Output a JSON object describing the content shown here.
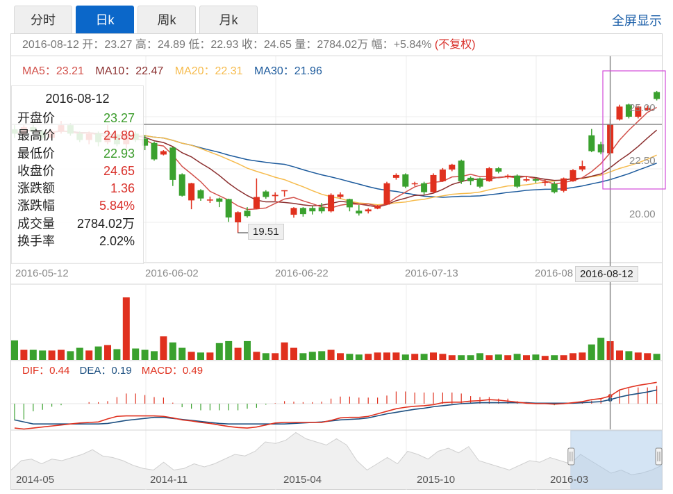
{
  "tabs": [
    {
      "label": "分时",
      "active": false
    },
    {
      "label": "日k",
      "active": true
    },
    {
      "label": "周k",
      "active": false
    },
    {
      "label": "月k",
      "active": false
    }
  ],
  "fullscreen_label": "全屏显示",
  "info": {
    "date": "2016-08-12",
    "open_label": "开：",
    "open": "23.27",
    "high_label": "高：",
    "high": "24.89",
    "low_label": "低：",
    "low": "22.93",
    "close_label": "收：",
    "close": "24.65",
    "volume_label": "量：",
    "volume": "2784.02万",
    "change_label": "幅：",
    "change": "+5.84%",
    "adjust": "(不复权)"
  },
  "ma": {
    "ma5": "MA5：23.21",
    "ma10": "MA10：22.47",
    "ma20": "MA20：22.31",
    "ma30": "MA30：21.96"
  },
  "tooltip": {
    "date": "2016-08-12",
    "rows": [
      {
        "label": "开盘价",
        "value": "23.27",
        "tone": "down"
      },
      {
        "label": "最高价",
        "value": "24.89",
        "tone": "up"
      },
      {
        "label": "最低价",
        "value": "22.93",
        "tone": "down"
      },
      {
        "label": "收盘价",
        "value": "24.65",
        "tone": "up"
      },
      {
        "label": "涨跌额",
        "value": "1.36",
        "tone": "up"
      },
      {
        "label": "涨跌幅",
        "value": "5.84%",
        "tone": "up"
      },
      {
        "label": "成交量",
        "value": "2784.02万",
        "tone": "plain"
      },
      {
        "label": "换手率",
        "value": "2.02%",
        "tone": "plain"
      }
    ]
  },
  "colors": {
    "up": "#e0301e",
    "down": "#3aa12e",
    "ma5": "#d2504a",
    "ma10": "#8b2f2f",
    "ma20": "#f6bb4c",
    "ma30": "#1c5a9c",
    "dif": "#e0301e",
    "dea": "#1c4f80",
    "accent": "#0b67c9"
  },
  "chart_data": {
    "type": "candlestick",
    "price_ticks": [
      "25.00",
      "22.50",
      "20.00"
    ],
    "price_tick_values": [
      25,
      22.5,
      20
    ],
    "x_labels": [
      "2016-05-12",
      "2016-06-02",
      "2016-06-22",
      "2016-07-13",
      "2016-08"
    ],
    "x_label_index": [
      0,
      14,
      28,
      42,
      56
    ],
    "selected_index": 64,
    "selected_date": "2016-08-12",
    "min_label": "19.51",
    "min_index": 24,
    "ohlc": [
      [
        24.4,
        24.2,
        24.6,
        24.0
      ],
      [
        24.2,
        24.5,
        24.6,
        24.1
      ],
      [
        24.5,
        24.3,
        24.7,
        24.2
      ],
      [
        24.3,
        24.0,
        24.4,
        23.9
      ],
      [
        24.0,
        24.3,
        24.4,
        23.9
      ],
      [
        24.3,
        24.6,
        24.8,
        24.2
      ],
      [
        24.6,
        24.2,
        24.7,
        24.1
      ],
      [
        24.2,
        23.9,
        24.3,
        23.8
      ],
      [
        23.9,
        24.2,
        24.3,
        23.7
      ],
      [
        24.2,
        23.8,
        24.3,
        23.6
      ],
      [
        23.8,
        24.1,
        24.6,
        23.7
      ],
      [
        24.1,
        23.7,
        24.2,
        23.6
      ],
      [
        23.7,
        24.2,
        24.4,
        23.5
      ],
      [
        24.2,
        23.9,
        24.3,
        23.8
      ],
      [
        23.96,
        23.63,
        24.12,
        23.42
      ],
      [
        23.76,
        22.98,
        23.82,
        22.92
      ],
      [
        23.21,
        23.37,
        23.42,
        23.17
      ],
      [
        23.54,
        22.01,
        23.57,
        21.72
      ],
      [
        22.27,
        21.26,
        22.32,
        21.22
      ],
      [
        21.04,
        21.85,
        21.87,
        20.62
      ],
      [
        21.52,
        21.13,
        21.57,
        21.02
      ],
      [
        21.04,
        21.08,
        21.22,
        20.92
      ],
      [
        21.13,
        20.97,
        21.17,
        20.72
      ],
      [
        21.1,
        20.23,
        21.12,
        20.02
      ],
      [
        20.0,
        20.48,
        20.52,
        19.51
      ],
      [
        20.55,
        20.29,
        20.72,
        20.22
      ],
      [
        20.65,
        21.2,
        22.08,
        20.62
      ],
      [
        21.46,
        21.2,
        21.52,
        21.12
      ],
      [
        21.24,
        21.3,
        21.42,
        21.02
      ],
      [
        21.49,
        21.52,
        21.52,
        21.22
      ],
      [
        20.36,
        20.68,
        20.72,
        20.22
      ],
      [
        20.68,
        20.39,
        20.72,
        20.27
      ],
      [
        20.68,
        20.52,
        20.77,
        20.37
      ],
      [
        20.71,
        20.52,
        20.92,
        20.42
      ],
      [
        20.52,
        21.3,
        21.37,
        20.47
      ],
      [
        21.2,
        21.32,
        21.42,
        21.12
      ],
      [
        21.1,
        20.71,
        21.12,
        20.52
      ],
      [
        20.55,
        20.42,
        20.82,
        20.32
      ],
      [
        20.52,
        20.61,
        20.67,
        20.42
      ],
      [
        20.65,
        20.77,
        20.82,
        20.62
      ],
      [
        20.84,
        21.85,
        21.92,
        20.82
      ],
      [
        22.11,
        22.24,
        22.32,
        22.02
      ],
      [
        22.27,
        21.69,
        22.32,
        21.62
      ],
      [
        21.82,
        21.85,
        21.92,
        21.72
      ],
      [
        21.85,
        21.43,
        21.92,
        21.32
      ],
      [
        21.43,
        22.24,
        22.32,
        21.37
      ],
      [
        21.95,
        22.5,
        22.57,
        21.92
      ],
      [
        22.5,
        22.73,
        22.77,
        22.42
      ],
      [
        22.92,
        21.95,
        22.97,
        21.82
      ],
      [
        22.11,
        21.95,
        22.17,
        21.77
      ],
      [
        22.08,
        21.69,
        22.12,
        21.62
      ],
      [
        21.95,
        22.56,
        22.62,
        21.92
      ],
      [
        22.56,
        22.4,
        22.62,
        22.32
      ],
      [
        22.14,
        22.21,
        22.27,
        22.07
      ],
      [
        22.21,
        21.69,
        22.27,
        21.62
      ],
      [
        21.98,
        22.04,
        22.17,
        21.92
      ],
      [
        22.04,
        21.97,
        22.12,
        21.87
      ],
      [
        21.87,
        21.92,
        22.02,
        21.72
      ],
      [
        21.82,
        21.43,
        21.92,
        21.37
      ],
      [
        21.49,
        22.08,
        22.12,
        21.42
      ],
      [
        21.95,
        22.47,
        22.52,
        21.92
      ],
      [
        22.5,
        22.66,
        22.92,
        22.42
      ],
      [
        24.12,
        23.37,
        24.42,
        23.32
      ],
      [
        23.7,
        23.31,
        23.82,
        23.22
      ],
      [
        23.27,
        24.65,
        24.89,
        22.93
      ],
      [
        24.87,
        25.48,
        25.57,
        24.82
      ],
      [
        25.58,
        25.0,
        25.62,
        24.92
      ],
      [
        25.0,
        25.48,
        25.52,
        24.92
      ],
      [
        25.32,
        25.42,
        25.52,
        25.27
      ],
      [
        26.17,
        25.84,
        26.22,
        25.77
      ]
    ],
    "volume_wan": [
      2900,
      1500,
      1500,
      1400,
      1400,
      1500,
      1300,
      1800,
      1400,
      2000,
      2200,
      1600,
      9300,
      1700,
      1500,
      1300,
      3500,
      2600,
      1800,
      1200,
      1100,
      1100,
      2500,
      2800,
      1800,
      2800,
      1200,
      1000,
      1000,
      2600,
      1800,
      1000,
      1200,
      1300,
      1500,
      1000,
      900,
      800,
      900,
      1100,
      1100,
      1100,
      800,
      900,
      900,
      1100,
      900,
      700,
      700,
      700,
      1000,
      700,
      800,
      700,
      900,
      700,
      800,
      600,
      700,
      700,
      1000,
      1100,
      2300,
      3300,
      2784,
      1400,
      1300,
      1100,
      1000,
      900
    ],
    "macd": [
      -0.33,
      -0.31,
      -0.15,
      -0.12,
      -0.06,
      -0.03,
      0,
      0,
      0.03,
      0.03,
      0.05,
      0.13,
      0.2,
      0.2,
      0.17,
      0.13,
      0.12,
      0.02,
      -0.07,
      -0.1,
      -0.13,
      -0.13,
      -0.13,
      -0.13,
      -0.13,
      -0.1,
      -0.08,
      -0.02,
      0.01,
      0.05,
      0.04,
      0.03,
      0.03,
      0.04,
      0.1,
      0.14,
      0.14,
      0.12,
      0.12,
      0.12,
      0.16,
      0.24,
      0.24,
      0.22,
      0.22,
      0.22,
      0.22,
      0.22,
      0.2,
      0.15,
      0.13,
      0.13,
      0.1,
      0.1,
      0.05,
      0.03,
      0.02,
      0.01,
      -0.03,
      0.01,
      0.02,
      0.03,
      0.06,
      0.1,
      0.2,
      0.28,
      0.3,
      0.32,
      0.32,
      0.35
    ],
    "dif": [
      -0.48,
      -0.5,
      -0.48,
      -0.46,
      -0.44,
      -0.42,
      -0.4,
      -0.38,
      -0.37,
      -0.36,
      -0.3,
      -0.25,
      -0.24,
      -0.24,
      -0.24,
      -0.24,
      -0.25,
      -0.28,
      -0.32,
      -0.34,
      -0.37,
      -0.39,
      -0.42,
      -0.45,
      -0.47,
      -0.48,
      -0.46,
      -0.42,
      -0.38,
      -0.37,
      -0.37,
      -0.37,
      -0.37,
      -0.37,
      -0.33,
      -0.28,
      -0.27,
      -0.27,
      -0.25,
      -0.2,
      -0.15,
      -0.1,
      -0.07,
      -0.05,
      -0.04,
      -0.02,
      0.02,
      0.03,
      0.03,
      0.05,
      0.06,
      0.08,
      0.07,
      0.05,
      0.03,
      0.01,
      0,
      0,
      -0.01,
      0,
      0.02,
      0.04,
      0.08,
      0.1,
      0.15,
      0.27,
      0.32,
      0.36,
      0.39,
      0.42
    ],
    "dea": [
      -0.32,
      -0.36,
      -0.4,
      -0.4,
      -0.4,
      -0.4,
      -0.4,
      -0.4,
      -0.4,
      -0.4,
      -0.39,
      -0.36,
      -0.33,
      -0.31,
      -0.29,
      -0.27,
      -0.27,
      -0.29,
      -0.31,
      -0.33,
      -0.35,
      -0.37,
      -0.39,
      -0.4,
      -0.4,
      -0.4,
      -0.4,
      -0.4,
      -0.4,
      -0.4,
      -0.39,
      -0.38,
      -0.37,
      -0.36,
      -0.34,
      -0.32,
      -0.31,
      -0.3,
      -0.28,
      -0.24,
      -0.2,
      -0.17,
      -0.14,
      -0.11,
      -0.09,
      -0.06,
      -0.04,
      -0.02,
      0,
      0.01,
      0.02,
      0.02,
      0.02,
      0.02,
      0.02,
      0.02,
      0.01,
      0.01,
      0.01,
      0.01,
      0.01,
      0.02,
      0.03,
      0.04,
      0.08,
      0.13,
      0.17,
      0.2,
      0.23,
      0.27
    ],
    "macd_labels": {
      "dif": "DIF：0.44",
      "dea": "DEA：0.19",
      "macd": "MACD：0.49"
    }
  },
  "navigator": {
    "labels": [
      "2014-05",
      "2014-11",
      "2015-04",
      "2015-10",
      "2016-03"
    ],
    "levels": [
      30,
      60,
      65,
      50,
      65,
      60,
      70,
      80,
      95,
      75,
      70,
      60,
      45,
      35,
      30,
      55,
      30,
      35,
      50,
      40,
      50,
      65,
      80,
      75,
      90,
      120,
      115,
      125,
      150,
      130,
      120,
      110,
      130,
      110,
      60,
      30,
      50,
      70,
      50,
      90,
      80,
      65,
      90,
      100,
      85,
      105,
      60,
      50,
      40,
      30,
      45,
      60,
      55,
      70,
      60,
      50,
      80,
      60,
      40,
      20,
      30,
      15,
      20,
      30,
      45
    ],
    "selection_start": 0.86,
    "selection_end": 1.0
  }
}
